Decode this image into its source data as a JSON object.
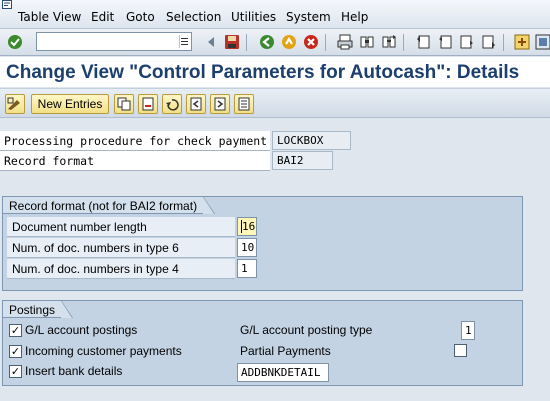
{
  "menu": {
    "items": [
      {
        "label": "Table View"
      },
      {
        "label": "Edit"
      },
      {
        "label": "Goto"
      },
      {
        "label": "Selection"
      },
      {
        "label": "Utilities"
      },
      {
        "label": "System"
      },
      {
        "label": "Help"
      }
    ]
  },
  "toolbar": {
    "command_field_value": "",
    "icons": [
      "enter-icon",
      "save-icon",
      "back-icon",
      "exit-icon",
      "cancel-icon",
      "print-icon",
      "find-icon",
      "find-next-icon",
      "first-page-icon",
      "previous-page-icon",
      "next-page-icon",
      "last-page-icon",
      "create-session-icon",
      "shortcut-icon"
    ]
  },
  "title": "Change View \"Control Parameters for Autocash\": Details",
  "app_toolbar": {
    "new_entries_label": "New Entries"
  },
  "header_fields": {
    "processing_label": "Processing procedure for check payment",
    "processing_value": "LOCKBOX",
    "record_format_label": "Record format",
    "record_format_value": "BAI2"
  },
  "record_format_group": {
    "title": "Record format (not for BAI2 format)",
    "doc_num_length_label": "Document number length",
    "doc_num_length_value": "16",
    "num_type6_label": "Num. of doc. numbers in type 6",
    "num_type6_value": "10",
    "num_type4_label": "Num. of doc. numbers in type 4",
    "num_type4_value": "1"
  },
  "postings_group": {
    "title": "Postings",
    "gl_postings_label": "G/L account postings",
    "gl_postings_checked": true,
    "incoming_payments_label": "Incoming customer payments",
    "incoming_payments_checked": true,
    "insert_bank_label": "Insert bank details",
    "insert_bank_checked": true,
    "gl_posting_type_label": "G/L account posting type",
    "gl_posting_type_value": "1",
    "partial_payments_label": "Partial Payments",
    "partial_payments_checked": false,
    "bank_detail_value": "ADDBNKDETAIL"
  },
  "colors": {
    "title": "#1c3f6e",
    "background": "#dfe6ee",
    "group_background": "#c3d3e4",
    "button_yellow": "#f2df86"
  }
}
